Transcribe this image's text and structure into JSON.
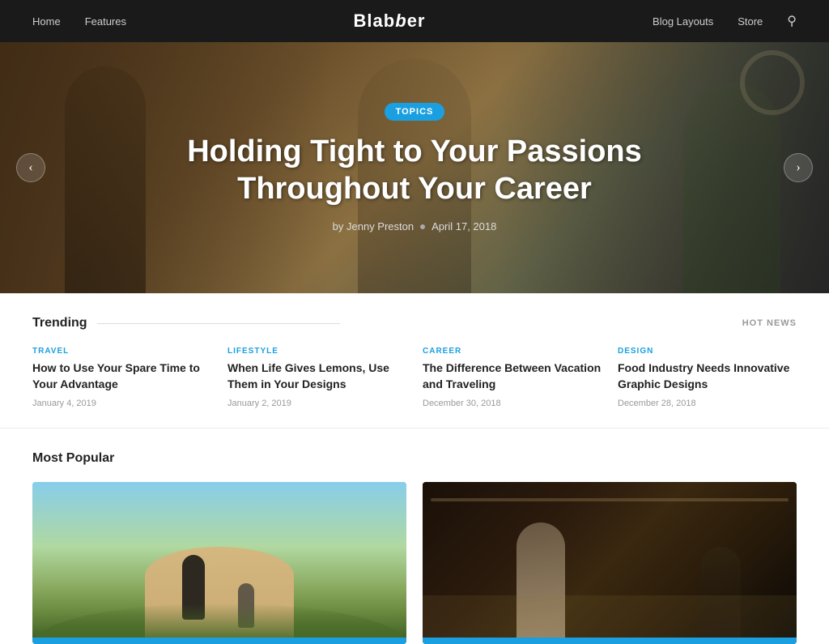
{
  "nav": {
    "links": [
      "Home",
      "Features",
      "Blog Layouts",
      "Store"
    ],
    "logo": "Blabber",
    "logo_serif": "Blab",
    "logo_bold": "ber"
  },
  "hero": {
    "badge": "TOPICS",
    "title": "Holding Tight to Your Passions Throughout Your Career",
    "author": "by Jenny Preston",
    "date": "April 17, 2018",
    "arrow_left": "‹",
    "arrow_right": "›"
  },
  "trending": {
    "section_title": "Trending",
    "hot_news_label": "HOT NEWS",
    "items": [
      {
        "category": "TRAVEL",
        "title": "How to Use Your Spare Time to Your Advantage",
        "date": "January 4, 2019"
      },
      {
        "category": "LIFESTYLE",
        "title": "When Life Gives Lemons, Use Them in Your Designs",
        "date": "January 2, 2019"
      },
      {
        "category": "CAREER",
        "title": "The Difference Between Vacation and Traveling",
        "date": "December 30, 2018"
      },
      {
        "category": "DESIGN",
        "title": "Food Industry Needs Innovative Graphic Designs",
        "date": "December 28, 2018"
      }
    ]
  },
  "popular": {
    "section_title": "Most Popular",
    "cards": [
      {
        "label": "runners-trail-image"
      },
      {
        "label": "workshop-craftsman-image"
      }
    ]
  },
  "icons": {
    "search": "🔍",
    "arrow_left": "‹",
    "arrow_right": "›"
  }
}
